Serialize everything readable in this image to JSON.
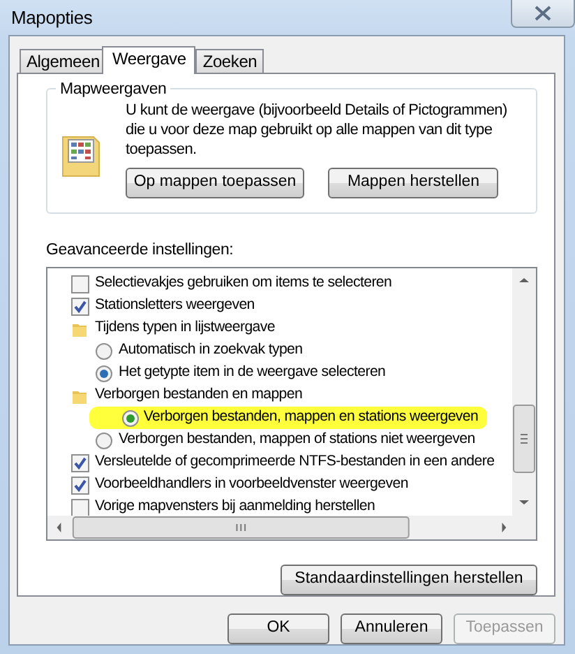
{
  "window": {
    "title": "Mapopties"
  },
  "tabs": [
    {
      "label": "Algemeen",
      "selected": false
    },
    {
      "label": "Weergave",
      "selected": true
    },
    {
      "label": "Zoeken",
      "selected": false
    }
  ],
  "folder_views": {
    "title": "Mapweergaven",
    "description": "U kunt de weergave (bijvoorbeeld Details of Pictogrammen) die u voor deze map gebruikt op alle mappen van dit type toepassen.",
    "buttons": [
      "Op mappen toepassen",
      "Mappen herstellen"
    ]
  },
  "advanced": {
    "label": "Geavanceerde instellingen:",
    "items": [
      {
        "kind": "checkbox",
        "label": "Selectievakjes gebruiken om items te selecteren",
        "checked": false
      },
      {
        "kind": "checkbox",
        "label": "Stationsletters weergeven",
        "checked": true
      },
      {
        "kind": "folder",
        "label": "Tijdens typen in lijstweergave",
        "children": [
          {
            "kind": "radio",
            "label": "Automatisch in zoekvak typen",
            "selected": false,
            "highlighted": false
          },
          {
            "kind": "radio",
            "label": "Het getypte item in de weergave selecteren",
            "selected": true,
            "highlighted": false
          }
        ]
      },
      {
        "kind": "folder",
        "label": "Verborgen bestanden en mappen",
        "children": [
          {
            "kind": "radio",
            "label": "Verborgen bestanden, mappen en stations weergeven",
            "selected": true,
            "highlighted": true
          },
          {
            "kind": "radio",
            "label": "Verborgen bestanden, mappen of stations niet weergeven",
            "selected": false,
            "highlighted": false
          }
        ]
      },
      {
        "kind": "checkbox",
        "label": "Versleutelde of gecomprimeerde NTFS-bestanden in een andere",
        "checked": true
      },
      {
        "kind": "checkbox",
        "label": "Voorbeeldhandlers in voorbeeldvenster weergeven",
        "checked": true
      },
      {
        "kind": "checkbox",
        "label": "Vorige mapvensters bij aanmelding herstellen",
        "checked": false
      }
    ]
  },
  "restore_button": "Standaardinstellingen herstellen",
  "buttons": [
    {
      "label": "OK",
      "disabled": false
    },
    {
      "label": "Annuleren",
      "disabled": false
    },
    {
      "label": "Toepassen",
      "disabled": true
    }
  ]
}
